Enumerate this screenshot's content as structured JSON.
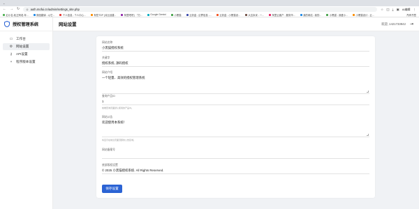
{
  "browser": {
    "tabs_button": "⌄",
    "url": "auth.mofui.cn/admin/settings_site.php",
    "user": "AI编辑",
    "bookmarks": [
      "幻小名-轮正阿老-年...",
      "微信翻译 - 以它...",
      "个人信息 - 个人中心...",
      "有些TDP (对比创建...",
      "阿里吧吧 | 「万...",
      "Google Gemini",
      "小黑猫",
      "云奶盒 - 幻界信息 -...",
      "云奶盒 - 小黑猫设...",
      "大吉米米 - 一...",
      "阿里云客户 - 服务市...",
      "我的网站 - 我的...",
      "小黑猫 - 我爱小...",
      "小黑猫设计 - 云..."
    ],
    "bookmarks_right": "所有书签"
  },
  "sidebar": {
    "brand": "授权管理系统",
    "items": [
      {
        "label": "工作台",
        "icon": "desktop-icon"
      },
      {
        "label": "网站设置",
        "icon": "gear-icon"
      },
      {
        "label": "API设置",
        "icon": "key-icon"
      },
      {
        "label": "程序版本设置",
        "icon": "code-branch-icon"
      }
    ]
  },
  "header": {
    "title": "网站设置",
    "user": "欢迎, 1421733942"
  },
  "form": {
    "site_name_label": "网站名称",
    "site_name_value": "小黑猫授权系统",
    "keywords_label": "关键字",
    "keywords_value": "授权系统, 源码授权",
    "description_label": "网站介绍",
    "description_value": "一个轻量、高效的授权管理系统",
    "qq_label": "查询产品ID",
    "qq_value": "1",
    "qq_hint": "前端查询页面默认使用的产品ID。",
    "notice_label": "网站公告",
    "notice_value": "欢迎使用本系统！",
    "notice_hint": "将显示在前台页面顶部的公告区域。",
    "icp_label": "网站备案号",
    "icp_value": "",
    "copyright_label": "底部版权设置",
    "copyright_value": "© 2025 小黑猫授权系统. All Rights Reserved.",
    "save_label": "保存设置"
  }
}
